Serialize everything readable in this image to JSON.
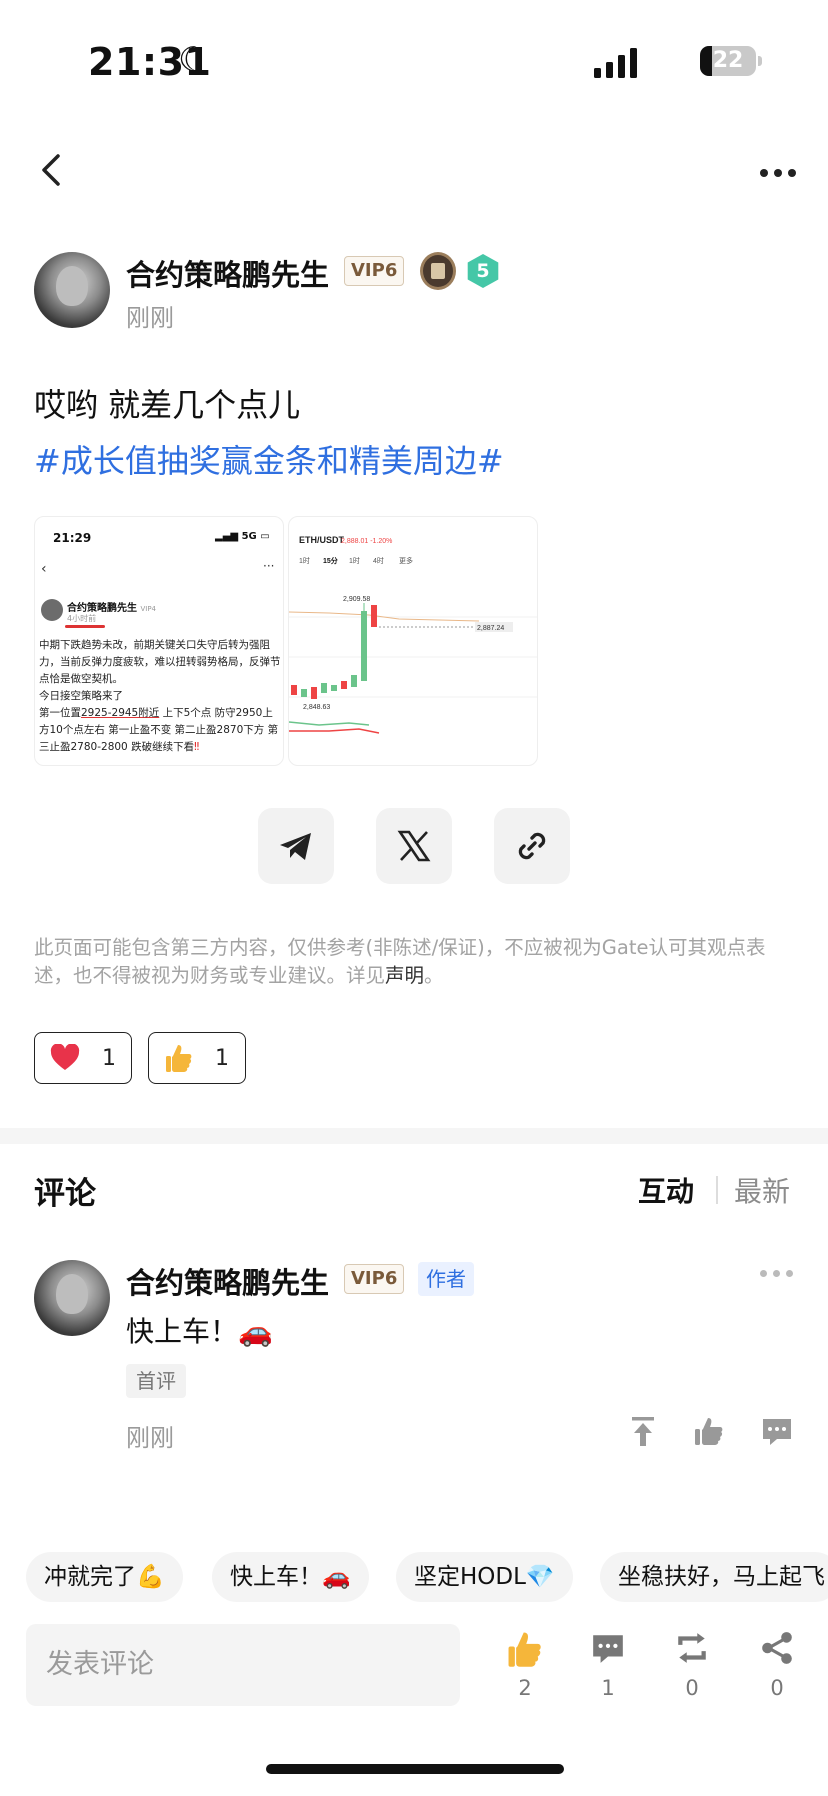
{
  "status_bar": {
    "time": "21:31",
    "battery": "22"
  },
  "post": {
    "author": {
      "name": "合约策略鹏先生",
      "vip": "VIP6",
      "level": "5",
      "time": "刚刚"
    },
    "text": "哎哟 就差几个点儿",
    "topic": "#成长值抽奖赢金条和精美周边#",
    "thumb1": {
      "time": "21:29",
      "status": "5G",
      "battery": "22",
      "author": "合约策略鹏先生",
      "vip": "VIP4",
      "subtime": "4小时前",
      "line1": "中期下跌趋势未改，前期关键关口失守后转为强阻力，当前反弹力度疲软，难以扭转弱势格局，反弹节点恰是做空契机。",
      "line2": "今日接空策略来了",
      "line3_a": "第一位置",
      "line3_b": "2925-2945附近",
      "line3_c": "上下5个点 防守2950上方10个点左右 第一止盈不变 第二止盈2870下方 第三止盈2780-2800 跌破继续下看",
      "line3_d": "‼"
    },
    "thumb2": {
      "pair": "ETH/USDT",
      "price": "2,888.01 -1.20%",
      "peak": "2,909.58",
      "last": "2,887.24",
      "low": "2,848.63",
      "intervals": [
        "1时",
        "15分",
        "1时",
        "4时",
        "更多"
      ]
    },
    "disclaimer": "此页面可能包含第三方内容，仅供参考(非陈述/保证)，不应被视为Gate认可其观点表述，也不得被视为财务或专业建议。详见",
    "disclaimer_link": "声明",
    "disclaimer_end": "。",
    "reactions": {
      "heart": "1",
      "thumb": "1"
    }
  },
  "comments": {
    "title": "评论",
    "tab_interact": "互动",
    "tab_latest": "最新",
    "items": [
      {
        "name": "合约策略鹏先生",
        "vip": "VIP6",
        "tag": "作者",
        "text": "快上车！🚗",
        "first": "首评",
        "time": "刚刚"
      }
    ]
  },
  "quick_replies": [
    "冲就完了💪",
    "快上车！🚗",
    "坚定HODL💎",
    "坐稳扶好，马上起飞"
  ],
  "bottom_bar": {
    "placeholder": "发表评论",
    "likes": "2",
    "comments": "1",
    "reposts": "0",
    "shares": "0"
  },
  "colors": {
    "topic_blue": "#2f6fe0",
    "heart_red": "#e8334a",
    "thumb_yellow": "#f5b63a",
    "level_green": "#45c7a7"
  }
}
